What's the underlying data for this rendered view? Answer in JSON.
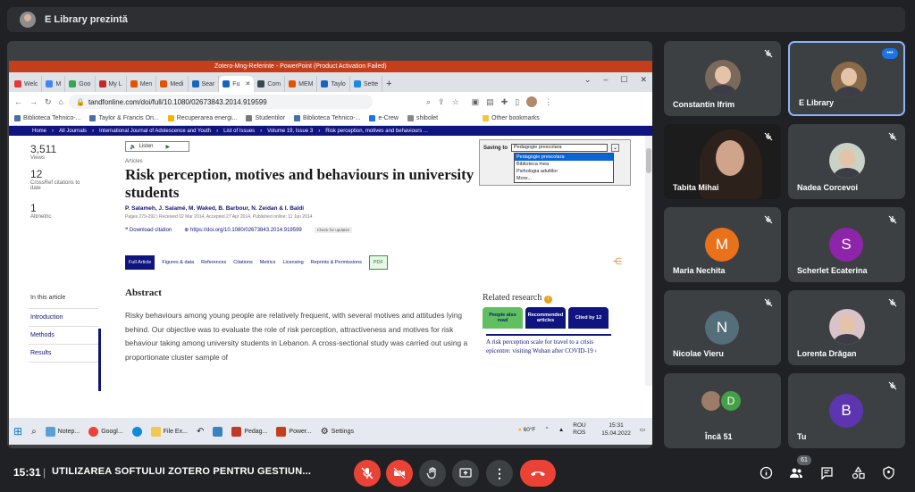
{
  "meet": {
    "presenting_label": "E Library prezintă",
    "clock": "15:31",
    "separator": "|",
    "meeting_title": "UTILIZAREA SOFTULUI ZOTERO PENTRU GESTIUN...",
    "people_count": "61"
  },
  "powerpoint": {
    "title": "Zotero-Mng-Referinte - PowerPoint (Product Activation Failed)"
  },
  "browser": {
    "tabs": [
      "Welc",
      "M",
      "Goo",
      "My L",
      "Men",
      "Medi",
      "Sear",
      "Fu",
      "Com",
      "MEM",
      "Taylo",
      "Sette"
    ],
    "url": "tandfonline.com/doi/full/10.1080/02673843.2014.919599",
    "bookmarks": [
      "Biblioteca Tehnico-...",
      "Taylor & Francis On...",
      "Recuperarea energi...",
      "Studentilor",
      "Biblioteca Tehnico-...",
      "e-Crew",
      "shibolet",
      "Other bookmarks"
    ]
  },
  "site_nav": [
    "Home",
    "All Journals",
    "International Journal of Adolescence and Youth",
    "List of Issues",
    "Volume 19, Issue 3",
    "Risk perception, motives and behaviours ..."
  ],
  "metrics": [
    {
      "value": "3,511",
      "label": "Views"
    },
    {
      "value": "12",
      "label": "CrossRef citations to date"
    },
    {
      "value": "1",
      "label": "Altmetric"
    }
  ],
  "article": {
    "listen": "Listen",
    "section": "Articles",
    "title": "Risk perception, motives and behaviours in university students",
    "authors": "P. Salameh, J. Salamé, M. Waked, B. Barbour, N. Zeidan & I. Baldi",
    "pubinfo": "Pages 279-292 | Received 02 Mar 2014, Accepted 27 Apr 2014, Published online: 11 Jun 2014",
    "download": "Download citation",
    "doi": "https://doi.org/10.1080/02673843.2014.919599",
    "check_updates": "Check for updates",
    "tabs": [
      "Full Article",
      "Figures & data",
      "References",
      "Citations",
      "Metrics",
      "Licensing",
      "Reprints & Permissions",
      "PDF"
    ],
    "abstract_heading": "Abstract",
    "abstract_text": "Risky behaviours among young people are relatively frequent, with several motives and attitudes lying behind. Our objective was to evaluate the role of risk perception, attractiveness and motives for risk behaviour taking among university students in Lebanon. A cross-sectional study was carried out using a proportionate cluster sample of"
  },
  "in_this_article": {
    "heading": "In this article",
    "items": [
      "Introduction",
      "Methods",
      "Results"
    ]
  },
  "related": {
    "heading": "Related research",
    "tabs": [
      "People also read",
      "Recommended articles",
      "Cited by 12"
    ],
    "first_item": "A risk perception scale for travel to a crisis epicentre: visiting Wuhan after COVID-19"
  },
  "zotero": {
    "saving_to": "Saving to",
    "selected": "Pedagogie prescolara",
    "options": [
      "Pedagogie prescolara",
      "Biblioteca mea",
      "Psihologia adultilor",
      "More..."
    ]
  },
  "taskbar": {
    "apps": [
      "Notep...",
      "Googl...",
      "File Ex...",
      "Pedag...",
      "Power...",
      "Settings"
    ],
    "weather": "60°F",
    "lang": "ROU ROS",
    "time": "15:31",
    "date": "15.04.2022"
  },
  "participants": [
    {
      "name": "Constantin Ifrim"
    },
    {
      "name": "E Library"
    },
    {
      "name": "Tabita Mihai"
    },
    {
      "name": "Nadea Corcevoi"
    },
    {
      "name": "Maria Nechita",
      "initial": "M",
      "color": "#e8711a"
    },
    {
      "name": "Scherlet Ecaterina",
      "initial": "S",
      "color": "#8e24aa"
    },
    {
      "name": "Nicolae Vieru",
      "initial": "N",
      "color": "#546e7a"
    },
    {
      "name": "Lorenta Drăgan"
    },
    {
      "name": "Încă 51",
      "initial": "D",
      "color": "#43a047"
    },
    {
      "name": "Tu",
      "initial": "B",
      "color": "#5e35b1"
    }
  ],
  "colors": {
    "accent": "#8ab4f8",
    "danger": "#ea4335",
    "journal_blue": "#10147e"
  }
}
